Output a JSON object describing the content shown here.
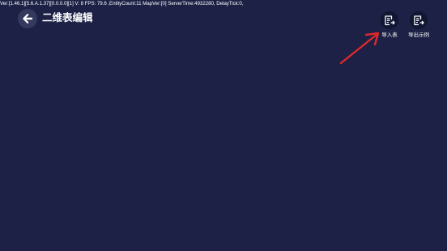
{
  "debug_bar": {
    "text": "Ver:[1.46.1][5.6.A.1.37][0.0.0.0][1] V: 8 FPS: 79.6   ,EntityCount:11   MapVer:[0]   ServerTime:4932280,    DelayTick:0,"
  },
  "header": {
    "back_icon": "left-arrow-icon",
    "title": "二维表编辑"
  },
  "toolbar": {
    "import_label": "导入表",
    "import_icon": "import-table-icon",
    "export_label": "导出示例",
    "export_icon": "export-example-icon"
  },
  "annotation": {
    "color": "#e0282c"
  },
  "colors": {
    "background": "#1c2145",
    "button_circle": "#111633",
    "back_circle": "#343a5e",
    "text": "#ffffff"
  }
}
